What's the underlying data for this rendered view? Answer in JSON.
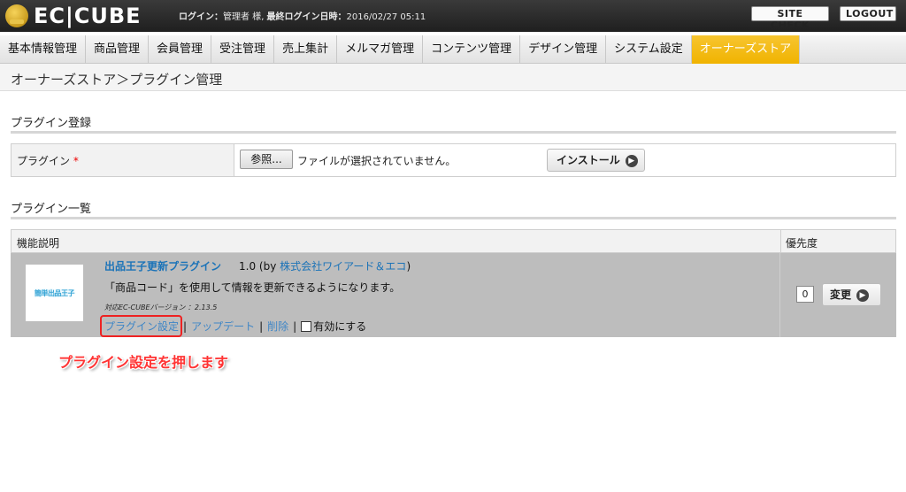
{
  "header": {
    "logo_text": "EC|CUBE",
    "login_label": "ログイン：",
    "login_user": "管理者 様",
    "last_login_label": "最終ログイン日時：",
    "last_login_value": "2016/02/27 05:11",
    "site_check_label": "SITE CHECK",
    "logout_label": "LOGOUT"
  },
  "nav": {
    "items": [
      "基本情報管理",
      "商品管理",
      "会員管理",
      "受注管理",
      "売上集計",
      "メルマガ管理",
      "コンテンツ管理",
      "デザイン管理",
      "システム設定",
      "オーナーズストア"
    ],
    "active_index": 9
  },
  "breadcrumb": "オーナーズストア＞プラグイン管理",
  "register": {
    "section_title": "プラグイン登録",
    "label": "プラグイン",
    "required_mark": "*",
    "browse_label": "参照...",
    "file_status": "ファイルが選択されていません。",
    "install_label": "インストール"
  },
  "list": {
    "section_title": "プラグイン一覧",
    "col_description": "機能説明",
    "col_priority": "優先度",
    "plugins": [
      {
        "name": "出品王子更新プラグイン",
        "version": "1.0",
        "by_prefix": "(by",
        "author": "株式会社ワイアード＆エコ",
        "by_suffix": ")",
        "description": "「商品コード」を使用して情報を更新できるようになります。",
        "compat": "対応EC-CUBEバージョン ：2.13.5",
        "settings_link": "プラグイン設定",
        "update_link": "アップデート",
        "delete_link": "削除",
        "enable_label": "有効にする",
        "enabled": false,
        "priority": "0",
        "change_label": "変更",
        "thumb_text": "簡単出品王子"
      }
    ]
  },
  "annotation": "プラグイン設定を押します",
  "colors": {
    "active_tab": "#f0b300",
    "link": "#1b73b8",
    "highlight": "#e22222",
    "row_bg": "#bdbdbd"
  }
}
